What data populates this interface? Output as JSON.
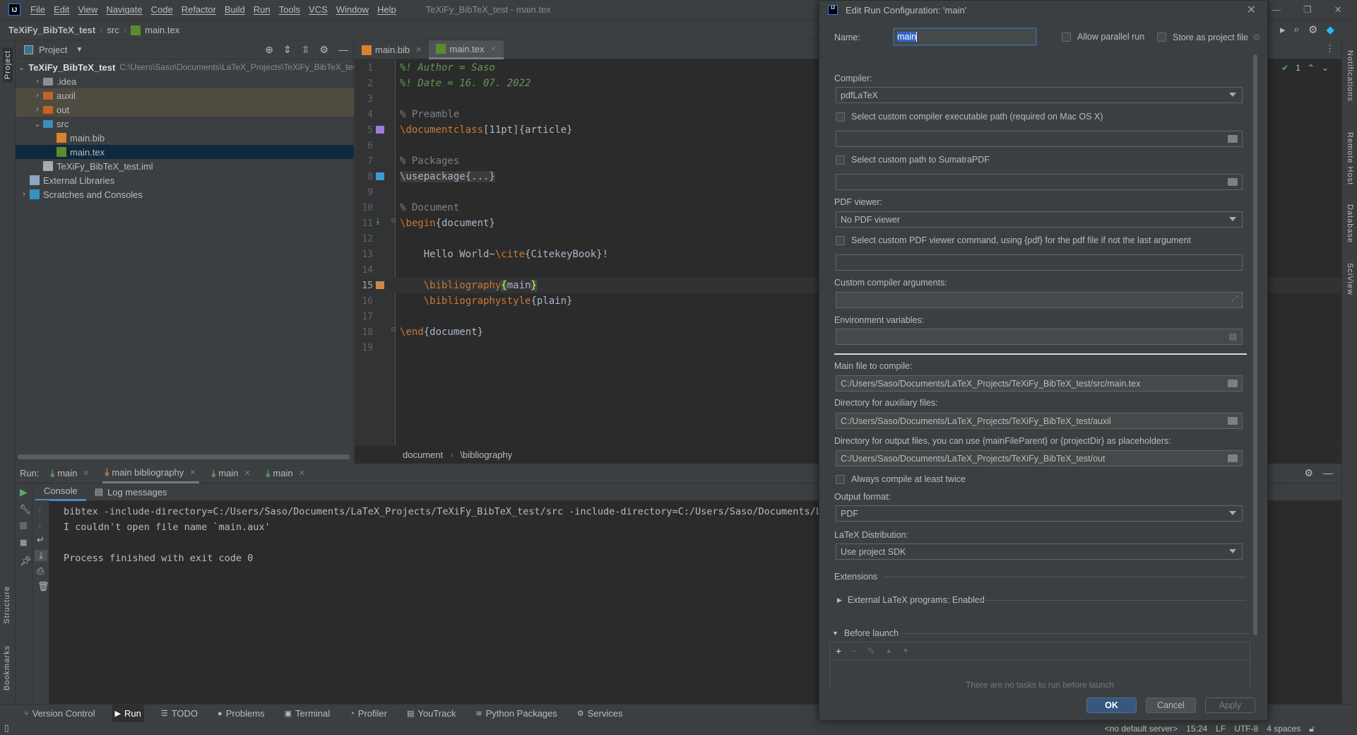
{
  "menubar": {
    "items": [
      "File",
      "Edit",
      "View",
      "Navigate",
      "Code",
      "Refactor",
      "Build",
      "Run",
      "Tools",
      "VCS",
      "Window",
      "Help"
    ],
    "window_title": "TeXiFy_BibTeX_test - main.tex",
    "logo": "IJ"
  },
  "navbar": {
    "crumbs": [
      "TeXiFy_BibTeX_test",
      "src",
      "main.tex"
    ]
  },
  "left_stripe": {
    "project": "Project",
    "structure": "Structure",
    "bookmarks": "Bookmarks"
  },
  "right_stripe": {
    "items": [
      "Notifications",
      "Remote Host",
      "Database",
      "SciView"
    ]
  },
  "project_panel": {
    "title": "Project",
    "tree": [
      {
        "label": "TeXiFy_BibTeX_test",
        "path": "C:\\Users\\Saso\\Documents\\LaTeX_Projects\\TeXiFy_BibTeX_test",
        "level": 0,
        "expand": "down",
        "icon": "module"
      },
      {
        "label": ".idea",
        "level": 1,
        "expand": "right",
        "icon": "folder-gray"
      },
      {
        "label": "auxil",
        "level": 1,
        "expand": "right",
        "icon": "folder-orange",
        "excluded": true
      },
      {
        "label": "out",
        "level": 1,
        "expand": "right",
        "icon": "folder-orange",
        "excluded": true
      },
      {
        "label": "src",
        "level": 1,
        "expand": "down",
        "icon": "folder-blue"
      },
      {
        "label": "main.bib",
        "level": 2,
        "icon": "bib"
      },
      {
        "label": "main.tex",
        "level": 2,
        "icon": "tex",
        "selected": true
      },
      {
        "label": "TeXiFy_BibTeX_test.iml",
        "level": 1,
        "icon": "iml"
      },
      {
        "label": "External Libraries",
        "level": 0,
        "icon": "libraries"
      },
      {
        "label": "Scratches and Consoles",
        "level": 0,
        "expand": "right",
        "icon": "scratches"
      }
    ]
  },
  "editor": {
    "tabs": [
      {
        "label": "main.bib",
        "icon": "bib"
      },
      {
        "label": "main.tex",
        "icon": "tex",
        "active": true
      }
    ],
    "inspection_count": "1",
    "lines": [
      [
        {
          "t": "%! Author = Saso",
          "c": "c-comment"
        }
      ],
      [
        {
          "t": "%! Date = 16. 07. 2022",
          "c": "c-comment"
        }
      ],
      [],
      [
        {
          "t": "% Preamble",
          "c": "c-gray"
        }
      ],
      [
        {
          "t": "\\documentclass",
          "c": "c-cmd"
        },
        {
          "t": "[11pt]{article}",
          "c": "c-text"
        }
      ],
      [],
      [
        {
          "t": "% Packages",
          "c": "c-gray"
        }
      ],
      [
        {
          "t": "\\usepackage{...}",
          "c": "c-fold"
        }
      ],
      [],
      [
        {
          "t": "% Document",
          "c": "c-gray"
        }
      ],
      [
        {
          "t": "\\begin",
          "c": "c-cmd"
        },
        {
          "t": "{document}",
          "c": "c-text"
        }
      ],
      [],
      [
        {
          "t": "    Hello World~",
          "c": "c-text"
        },
        {
          "t": "\\cite",
          "c": "c-cmd"
        },
        {
          "t": "{CitekeyBook}!",
          "c": "c-text"
        }
      ],
      [],
      [
        {
          "t": "    \\bibliography",
          "c": "c-cmd"
        },
        {
          "t": "{",
          "c": "c-brace"
        },
        {
          "t": "main",
          "c": "c-text"
        },
        {
          "t": "}",
          "c": "c-brace"
        }
      ],
      [
        {
          "t": "    \\bibliographystyle",
          "c": "c-cmd"
        },
        {
          "t": "{plain}",
          "c": "c-text"
        }
      ],
      [],
      [
        {
          "t": "\\end",
          "c": "c-cmd"
        },
        {
          "t": "{document}",
          "c": "c-text"
        }
      ],
      []
    ],
    "breadcrumb": [
      "document",
      "\\bibliography"
    ]
  },
  "run_panel": {
    "label": "Run:",
    "tabs": [
      {
        "label": "main"
      },
      {
        "label": "main bibliography",
        "active": true
      },
      {
        "label": "main"
      },
      {
        "label": "main"
      }
    ],
    "console_tabs": [
      "Console",
      "Log messages"
    ],
    "console_lines": [
      "bibtex -include-directory=C:/Users/Saso/Documents/LaTeX_Projects/TeXiFy_BibTeX_test/src -include-directory=C:/Users/Saso/Documents/LaTeX_Projects/TeXiFy_BibTeX_test/src main",
      "I couldn't open file name `main.aux'",
      "",
      "Process finished with exit code 0"
    ]
  },
  "bottom_tools": [
    "Version Control",
    "Run",
    "TODO",
    "Problems",
    "Terminal",
    "Profiler",
    "YouTrack",
    "Python Packages",
    "Services"
  ],
  "status_bar": [
    "<no default server>",
    "15:24",
    "LF",
    "UTF-8",
    "4 spaces"
  ],
  "dialog": {
    "title": "Edit Run Configuration: 'main'",
    "name_label": "Name:",
    "name_value": "main",
    "allow_parallel": "Allow parallel run",
    "store_project": "Store as project file",
    "compiler_label": "Compiler:",
    "compiler_value": "pdfLaTeX",
    "custom_compiler_cb": "Select custom compiler executable path (required on Mac OS X)",
    "sumatra_cb": "Select custom path to SumatraPDF",
    "pdf_viewer_label": "PDF viewer:",
    "pdf_viewer_value": "No PDF viewer",
    "custom_viewer_cb": "Select custom PDF viewer command, using {pdf} for the pdf file if not the last argument",
    "compiler_args_label": "Custom compiler arguments:",
    "env_label": "Environment variables:",
    "main_file_label": "Main file to compile:",
    "main_file_value": "C:/Users/Saso/Documents/LaTeX_Projects/TeXiFy_BibTeX_test/src/main.tex",
    "aux_label": "Directory for auxiliary files:",
    "aux_value": "C:/Users/Saso/Documents/LaTeX_Projects/TeXiFy_BibTeX_test/auxil",
    "out_label": "Directory for output files, you can use {mainFileParent} or {projectDir} as placeholders:",
    "out_value": "C:/Users/Saso/Documents/LaTeX_Projects/TeXiFy_BibTeX_test/out",
    "twice_cb": "Always compile at least twice",
    "format_label": "Output format:",
    "format_value": "PDF",
    "distribution_label": "LaTeX Distribution:",
    "distribution_value": "Use project SDK",
    "extensions_label": "Extensions",
    "external_programs": "External LaTeX programs: Enabled",
    "before_launch": "Before launch",
    "no_tasks": "There are no tasks to run before launch",
    "ok": "OK",
    "cancel": "Cancel",
    "apply": "Apply"
  },
  "colors": {
    "accent": "#365880",
    "selection": "#0d293e",
    "excluded": "#4f4b41",
    "editor_bg": "#2b2b2b",
    "panel_bg": "#3c3f41"
  }
}
